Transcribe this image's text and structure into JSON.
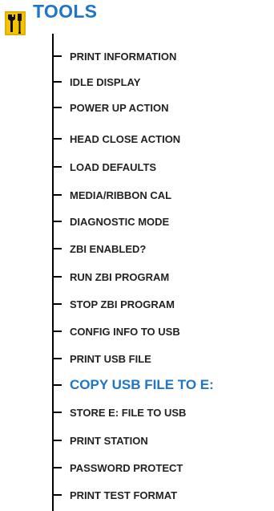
{
  "header": {
    "title": "TOOLS",
    "icon": "tools-icon",
    "accent_color": "#1f75c7",
    "icon_background": "#f5c400"
  },
  "menu": {
    "items": [
      {
        "label": "PRINT INFORMATION"
      },
      {
        "label": "IDLE DISPLAY"
      },
      {
        "label": "POWER UP ACTION"
      },
      {
        "label": "HEAD CLOSE ACTION"
      },
      {
        "label": "LOAD DEFAULTS"
      },
      {
        "label": "MEDIA/RIBBON CAL"
      },
      {
        "label": "DIAGNOSTIC MODE"
      },
      {
        "label": "ZBI ENABLED?"
      },
      {
        "label": "RUN ZBI PROGRAM"
      },
      {
        "label": "STOP ZBI PROGRAM"
      },
      {
        "label": "CONFIG INFO TO USB"
      },
      {
        "label": "PRINT USB FILE"
      },
      {
        "label": "COPY USB FILE TO E:"
      },
      {
        "label": "STORE E: FILE TO USB"
      },
      {
        "label": "PRINT STATION"
      },
      {
        "label": "PASSWORD PROTECT"
      },
      {
        "label": "PRINT TEST FORMAT"
      }
    ],
    "selected": "COPY USB FILE TO E:"
  }
}
